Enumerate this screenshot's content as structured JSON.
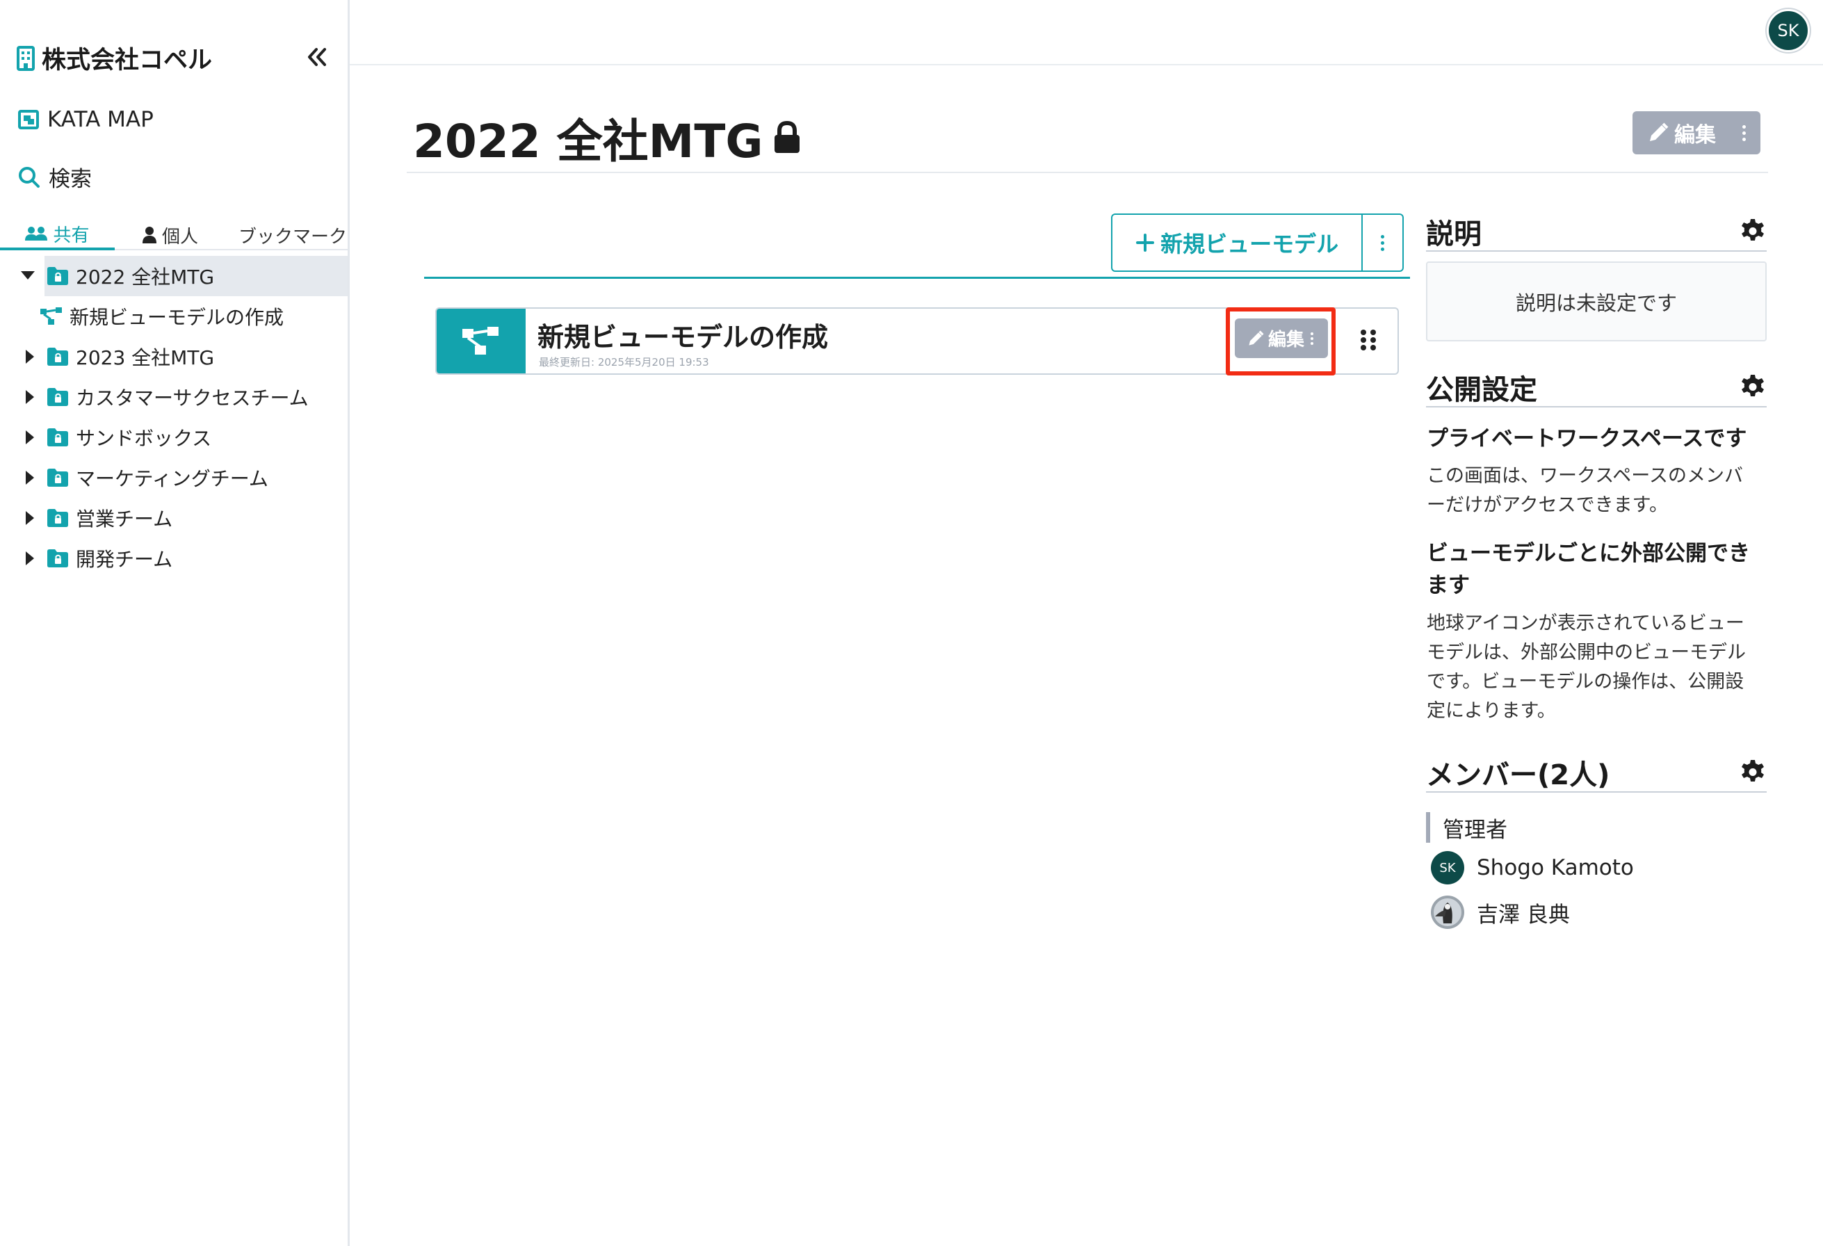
{
  "sidebar": {
    "brand": "株式会社コペル",
    "nav": [
      {
        "label": "KATA MAP",
        "icon": "map-icon"
      },
      {
        "label": "検索",
        "icon": "search-icon"
      }
    ],
    "tabs": [
      {
        "label": "共有",
        "icon": "users-icon",
        "active": true
      },
      {
        "label": "個人",
        "icon": "user-icon",
        "active": false
      },
      {
        "label": "ブックマーク",
        "icon": "",
        "active": false
      }
    ],
    "tree": [
      {
        "label": "2022 全社MTG",
        "type": "folder",
        "expanded": true,
        "selected": true
      },
      {
        "label": "新規ビューモデルの作成",
        "type": "viewmodel"
      },
      {
        "label": "2023 全社MTG",
        "type": "folder"
      },
      {
        "label": "カスタマーサクセスチーム",
        "type": "folder"
      },
      {
        "label": "サンドボックス",
        "type": "folder"
      },
      {
        "label": "マーケティングチーム",
        "type": "folder"
      },
      {
        "label": "営業チーム",
        "type": "folder"
      },
      {
        "label": "開発チーム",
        "type": "folder"
      }
    ]
  },
  "header": {
    "avatar_initials": "SK"
  },
  "page": {
    "title": "2022 全社MTG",
    "edit_label": "編集",
    "new_viewmodel_label": "新規ビューモデル"
  },
  "cards": [
    {
      "title": "新規ビューモデルの作成",
      "updated": "最終更新日: 2025年5月20日 19:53",
      "edit_label": "編集"
    }
  ],
  "right_panel": {
    "description": {
      "heading": "説明",
      "empty_text": "説明は未設定です"
    },
    "visibility": {
      "heading": "公開設定",
      "private_title": "プライベートワークスペースです",
      "private_line1": "この画面は、ワークスペースのメンバ",
      "private_line2": "ーだけがアクセスできます。",
      "public_title_line1": "ビューモデルごとに外部公開でき",
      "public_title_line2": "ます",
      "public_line1": "地球アイコンが表示されているビュー",
      "public_line2": "モデルは、外部公開中のビューモデル",
      "public_line3": "です。ビューモデルの操作は、公開設",
      "public_line4": "定によります。"
    },
    "members": {
      "heading": "メンバー(2人)",
      "role": "管理者",
      "list": [
        {
          "name": "Shogo Kamoto",
          "initials": "SK"
        },
        {
          "name": "吉澤 良典",
          "initials": ""
        }
      ]
    }
  },
  "colors": {
    "accent": "#13a3ad",
    "muted_button": "#a3aab8",
    "highlight": "#f22c14",
    "avatar": "#0d4a48"
  }
}
